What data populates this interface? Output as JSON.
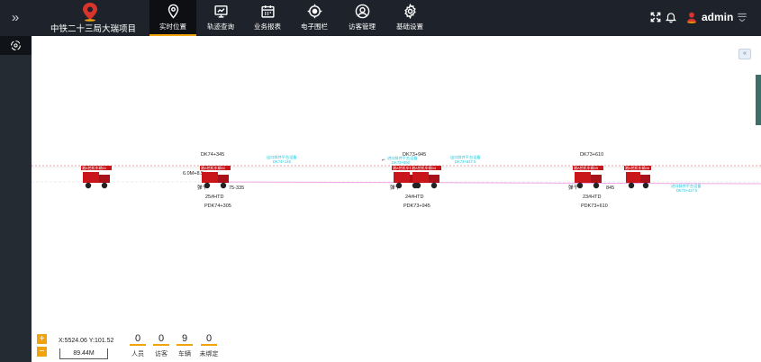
{
  "app": {
    "title": "中铁二十三局大瑞项目"
  },
  "nav": [
    {
      "label": "实时位置",
      "icon": "location-pin-icon",
      "active": true
    },
    {
      "label": "轨迹查询",
      "icon": "monitor-track-icon",
      "active": false
    },
    {
      "label": "业务报表",
      "icon": "calendar-report-icon",
      "active": false
    },
    {
      "label": "电子围栏",
      "icon": "fence-target-icon",
      "active": false
    },
    {
      "label": "访客管理",
      "icon": "visitor-user-icon",
      "active": false
    },
    {
      "label": "基础设置",
      "icon": "gear-icon",
      "active": false
    }
  ],
  "user": {
    "name": "admin"
  },
  "colors": {
    "accent": "#f0a30a",
    "topbar": "#1e232b",
    "sidebar": "#252b33",
    "vehicle": "#c8161a",
    "cyan_label": "#19c9e0",
    "pink_line": "#f0a8e8"
  },
  "map": {
    "mileage_labels": [
      {
        "top": "DK74+345",
        "mid": "6.0M+8.5",
        "side": "75-335",
        "prefix": "弹千",
        "bottom1": "25#HTD",
        "bottom2": "PDK74+305"
      },
      {
        "top": "DK73+945",
        "mid": "",
        "side": "",
        "prefix": "弹千",
        "bottom1": "24#HTD",
        "bottom2": "PDK73+945"
      },
      {
        "top": "DK73+610",
        "mid": "",
        "side": "845",
        "prefix": "弹千",
        "bottom1": "23#HTD",
        "bottom2": "PDK73+610"
      }
    ],
    "cyan_labels": [
      {
        "line1": "出口斜井平台设备",
        "line2": "DK74+145"
      },
      {
        "line1": "进口斜井平台设备",
        "line2": "DK73+890"
      },
      {
        "line1": "出口斜井平台设备",
        "line2": "DK73+947.5"
      },
      {
        "line1": "进口斜井平台设备",
        "line2": "DK73+427.5"
      }
    ],
    "vehicle_labels": [
      "湘A挖机车辆01",
      "湘A挖机车辆02",
      "湘A挖机车辆03",
      "湘A挖机车辆04",
      "湘A挖机车辆05",
      "湘A挖机车辆06"
    ]
  },
  "footer": {
    "coords": "X:5524.06 Y:101.52",
    "scale": "89.44M",
    "zoom_in": "+",
    "zoom_out": "−"
  },
  "stats": [
    {
      "value": "0",
      "label": "人员"
    },
    {
      "value": "0",
      "label": "访客"
    },
    {
      "value": "9",
      "label": "车辆"
    },
    {
      "value": "0",
      "label": "未绑定"
    }
  ]
}
